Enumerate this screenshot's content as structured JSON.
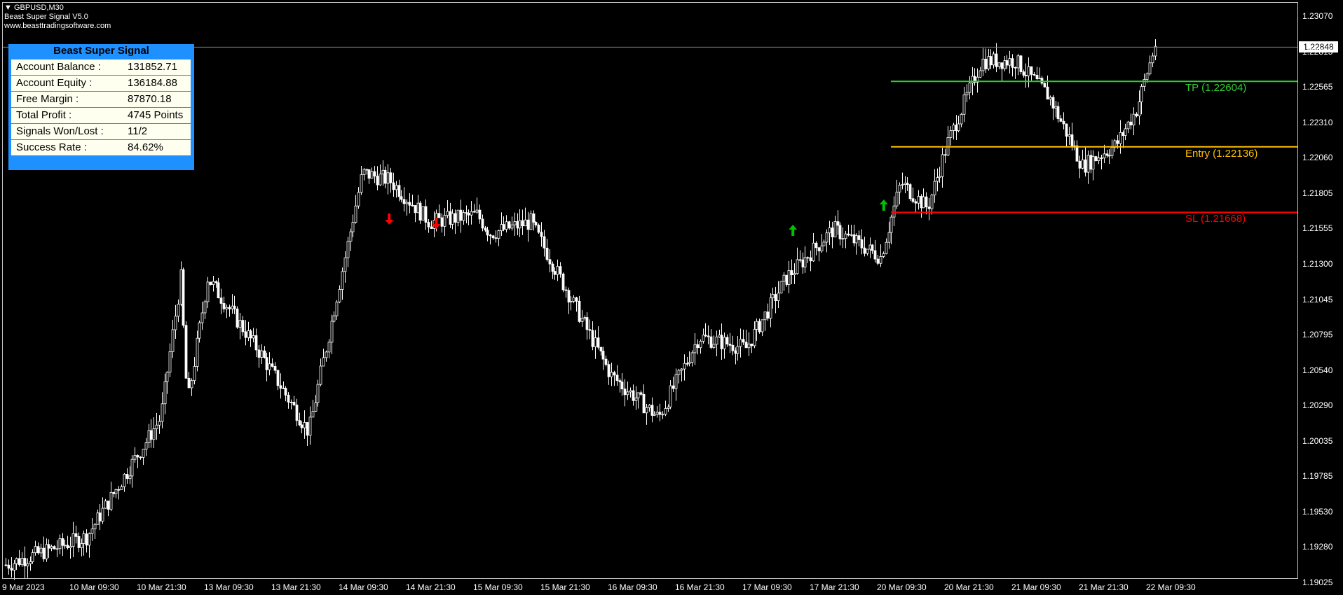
{
  "chart_header": {
    "symbol": "GBPUSD,M30",
    "indicator": "Beast Super Signal V5.0",
    "website": "www.beasttradingsoftware.com"
  },
  "panel": {
    "title": "Beast Super Signal",
    "rows": [
      {
        "label": "Account Balance :",
        "value": "131852.71"
      },
      {
        "label": "Account Equity :",
        "value": "136184.88"
      },
      {
        "label": "Free Margin :",
        "value": "87870.18"
      },
      {
        "label": "Total Profit :",
        "value": "4745 Points"
      },
      {
        "label": "Signals Won/Lost :",
        "value": "11/2"
      },
      {
        "label": "Success Rate :",
        "value": "84.62%"
      }
    ]
  },
  "current_price": "1.22848",
  "levels": {
    "tp": {
      "label": "TP (1.22604)",
      "value": 1.22604,
      "color": "#32cd32"
    },
    "entry": {
      "label": "Entry (1.22136)",
      "value": 1.22136,
      "color": "#ffc000"
    },
    "sl": {
      "label": "SL (1.21668)",
      "value": 1.21668,
      "color": "#ff0000"
    }
  },
  "colors": {
    "background": "#000000",
    "candles": "#ffffff",
    "panel": "#1e90ff",
    "buy_arrow": "#00c000",
    "sell_arrow": "#ff0000"
  },
  "chart_data": {
    "type": "line",
    "title": "GBPUSD,M30",
    "xlabel": "",
    "ylabel": "",
    "ylim": [
      1.189,
      1.232
    ],
    "y_ticks": [
      "1.23070",
      "1.22815",
      "1.22565",
      "1.22310",
      "1.22060",
      "1.21805",
      "1.21555",
      "1.21300",
      "1.21045",
      "1.20795",
      "1.20540",
      "1.20290",
      "1.20035",
      "1.19785",
      "1.19530",
      "1.19280",
      "1.19025"
    ],
    "x_ticks": [
      "9 Mar 2023",
      "10 Mar 09:30",
      "10 Mar 21:30",
      "13 Mar 09:30",
      "13 Mar 21:30",
      "14 Mar 09:30",
      "14 Mar 21:30",
      "15 Mar 09:30",
      "15 Mar 21:30",
      "16 Mar 09:30",
      "16 Mar 21:30",
      "17 Mar 09:30",
      "17 Mar 21:30",
      "20 Mar 09:30",
      "20 Mar 21:30",
      "21 Mar 09:30",
      "21 Mar 21:30",
      "22 Mar 09:30"
    ],
    "x": [
      0,
      1.2,
      2.3,
      2.6,
      2.7,
      3.0,
      3.8,
      4.5,
      5.3,
      5.7,
      6.3,
      7.0,
      7.2,
      7.8,
      9.0,
      9.7,
      10.3,
      11.0,
      11.6,
      12.3,
      13.0,
      13.3,
      13.7,
      14.0,
      14.5,
      15.0,
      15.5,
      16.0,
      16.5,
      16.8,
      17.1
    ],
    "series": [
      {
        "values": [
          1.1915,
          1.1935,
          1.202,
          1.212,
          1.203,
          1.212,
          1.2065,
          1.201,
          1.2195,
          1.219,
          1.216,
          1.2165,
          1.2152,
          1.216,
          1.205,
          1.202,
          1.2078,
          1.207,
          1.212,
          1.2155,
          1.2135,
          1.2188,
          1.217,
          1.2217,
          1.2275,
          1.2275,
          1.225,
          1.22,
          1.2215,
          1.224,
          1.229
        ]
      }
    ],
    "signals": [
      {
        "type": "sell",
        "x": 5.7,
        "y": 1.2162
      },
      {
        "type": "sell",
        "x": 6.4,
        "y": 1.2159
      },
      {
        "type": "buy",
        "x": 11.7,
        "y": 1.2154
      },
      {
        "type": "buy",
        "x": 13.05,
        "y": 1.2172
      }
    ]
  }
}
